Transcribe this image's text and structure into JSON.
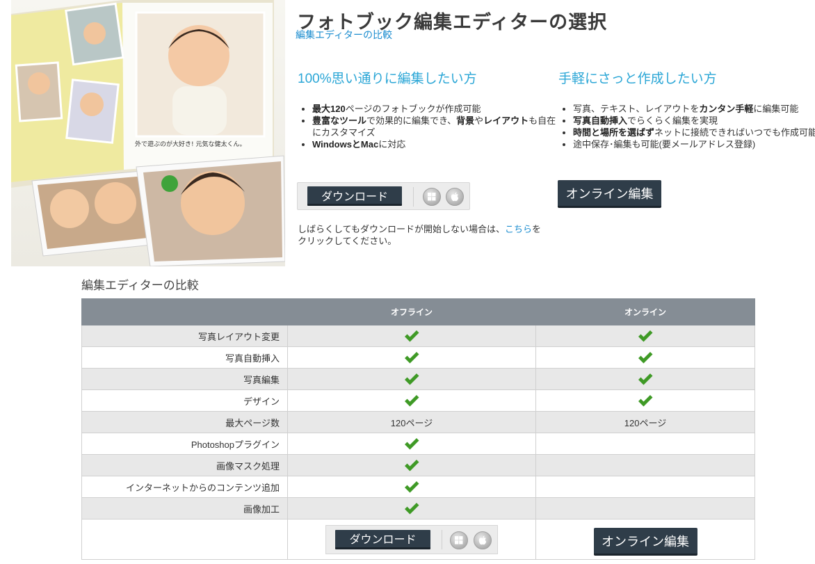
{
  "header": {
    "title": "フォトブック編集エディターの選択",
    "compare_link": "編集エディターの比較"
  },
  "hero": {
    "caption": "外で遊ぶのが大好き! 元気な健太くん。"
  },
  "offline_column": {
    "heading": "100%思い通りに編集したい方",
    "features": [
      [
        "最大120",
        "ページのフォトブックが作成可能",
        ""
      ],
      [
        "豊富なツール",
        "で効果的に編集でき、",
        "背景",
        "や",
        "レイアウト",
        "も自在にカスタマイズ"
      ],
      [
        "WindowsとMac",
        "に対応"
      ]
    ],
    "download_label": "ダウンロード",
    "note_before": "しばらくしてもダウンロードが開始しない場合は、",
    "note_link": "こちら",
    "note_after": "をクリックしてください。"
  },
  "online_column": {
    "heading": "手軽にさっと作成したい方",
    "features": [
      [
        "写真、テキスト、レイアウトを",
        "カンタン手軽",
        "に編集可能"
      ],
      [
        "写真自動挿入",
        "でらくらく編集を実現"
      ],
      [
        "時間と場所を選ばず",
        "ネットに接続できればいつでも作成可能"
      ],
      [
        "途中保存･編集も可能(要メールアドレス登録)"
      ]
    ],
    "online_label": "オンライン編集"
  },
  "comparison": {
    "section_title": "編集エディターの比較",
    "columns": [
      "",
      "オフライン",
      "オンライン"
    ],
    "rows": [
      {
        "label": "写真レイアウト変更",
        "offline": "check",
        "online": "check"
      },
      {
        "label": "写真自動挿入",
        "offline": "check",
        "online": "check"
      },
      {
        "label": "写真編集",
        "offline": "check",
        "online": "check"
      },
      {
        "label": "デザイン",
        "offline": "check",
        "online": "check"
      },
      {
        "label": "最大ページ数",
        "offline": "120ページ",
        "online": "120ページ"
      },
      {
        "label": "Photoshopプラグイン",
        "offline": "check",
        "online": ""
      },
      {
        "label": "画像マスク処理",
        "offline": "check",
        "online": ""
      },
      {
        "label": "インターネットからのコンテンツ追加",
        "offline": "check",
        "online": ""
      },
      {
        "label": "画像加工",
        "offline": "check",
        "online": ""
      }
    ],
    "download_label": "ダウンロード",
    "online_label": "オンライン編集"
  },
  "icons": {
    "windows": "windows-icon",
    "apple": "apple-icon",
    "check": "check-icon"
  },
  "colors": {
    "accent_blue": "#2aa6d6",
    "link_blue": "#1a8ccf",
    "button_dark": "#2f3d49",
    "table_header": "#858d95",
    "check_green": "#3f9a26"
  }
}
